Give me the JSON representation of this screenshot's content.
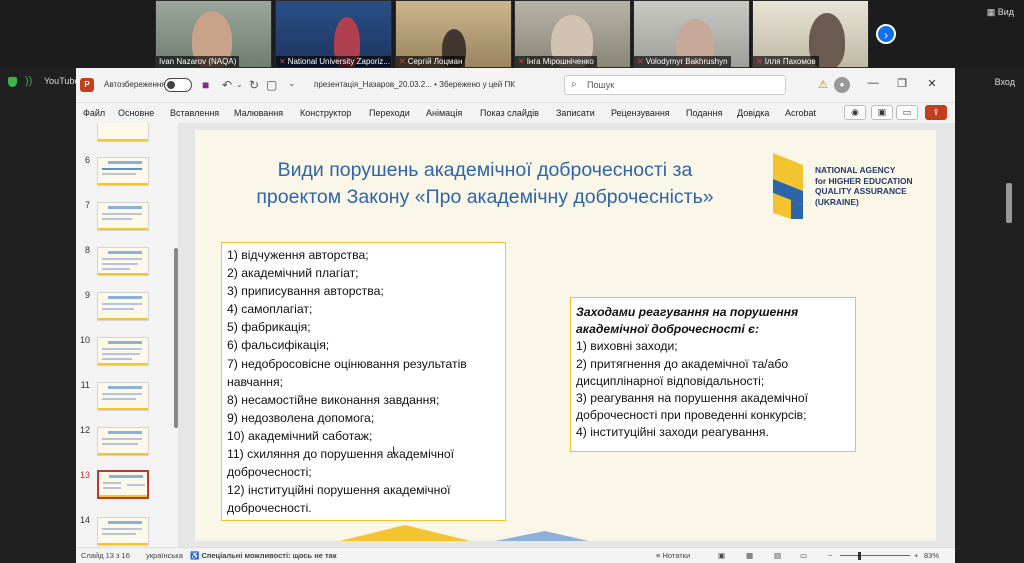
{
  "zoom": {
    "participants": [
      {
        "name": "Ivan Nazarov (NAQA)",
        "muted": false
      },
      {
        "name": "National University Zaporiz...",
        "muted": true
      },
      {
        "name": "Сергій Лоцман",
        "muted": true
      },
      {
        "name": "Інга Мірошніченко",
        "muted": true
      },
      {
        "name": "Volodymyr Bakhrushyn",
        "muted": true
      },
      {
        "name": "Ілля Пахомов",
        "muted": true
      }
    ],
    "view_label": "Вид",
    "next_icon": "chevron-right-icon",
    "exit_label": "Вход"
  },
  "browser": {
    "tab_label": "YouTube"
  },
  "ppt": {
    "autosave_label": "Автозбереження",
    "document_title": "презентація_Назаров_20.03.2... • Збережено у цей ПК",
    "search_placeholder": "Пошук",
    "menu": [
      "Файл",
      "Основне",
      "Вставлення",
      "Малювання",
      "Конструктор",
      "Переходи",
      "Анімація",
      "Показ слайдів",
      "Записати",
      "Рецензування",
      "Подання",
      "Довідка",
      "Acrobat"
    ],
    "thumb_numbers": [
      "6",
      "7",
      "8",
      "9",
      "10",
      "11",
      "12",
      "13",
      "14"
    ],
    "active_slide": "13",
    "status": {
      "slide_counter": "Слайд 13 з 16",
      "language": "українська",
      "accessibility": "Спеціальні можливості: щось не так",
      "notes": "Нотатки",
      "zoom": "83%"
    }
  },
  "slide": {
    "title_line1": "Види порушень академічної доброчесності за",
    "title_line2": "проектом Закону «Про академічну доброчесність»",
    "logo_lines": [
      "NATIONAL AGENCY",
      "for HIGHER EDUCATION",
      "QUALITY ASSURANCE",
      "(UKRAINE)"
    ],
    "violations": [
      "1) відчуження авторства;",
      "2) академічний плагіат;",
      "3) приписування авторства;",
      "4) самоплагіат;",
      "5) фабрикація;",
      "6) фальсифікація;",
      "7) недобросовісне оцінювання результатів навчання;",
      "8) несамостійне виконання завдання;",
      "9) недозволена допомога;",
      "10) академічний саботаж;",
      "11) схиляння до порушення академічної доброчесності;",
      "12) інституційні порушення академічної доброчесності."
    ],
    "measures_heading": "Заходами реагування на порушення академічної доброчесності є:",
    "measures": [
      "1) виховні заходи;",
      "2) притягнення до академічної та/або дисциплінарної відповідальності;",
      "3) реагування на порушення академічної доброчесності при  проведенні конкурсів;",
      "4) інституційні заходи реагування."
    ]
  },
  "colors": {
    "title_blue": "#2e65a8",
    "box_border": "#f4c430",
    "slide_bg": "#fbf7e8",
    "logo_blue": "#1f3a6b",
    "logo_yellow": "#f4c430"
  }
}
